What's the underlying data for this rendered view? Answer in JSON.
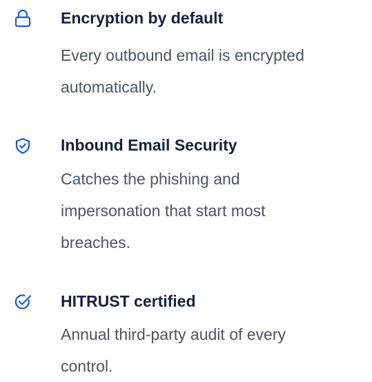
{
  "accent_color": "#1a5bd6",
  "features": [
    {
      "icon": "lock-icon",
      "title": "Encryption by default",
      "description_lines": [
        "Every outbound email is encrypted",
        "automatically."
      ]
    },
    {
      "icon": "shield-check-icon",
      "title": "Inbound Email Security",
      "description_lines": [
        "Catches the phishing and",
        "impersonation that start most",
        "breaches."
      ]
    },
    {
      "icon": "badge-check-icon",
      "title": "HITRUST certified",
      "description_lines": [
        "Annual third-party audit of every",
        "control."
      ]
    }
  ]
}
